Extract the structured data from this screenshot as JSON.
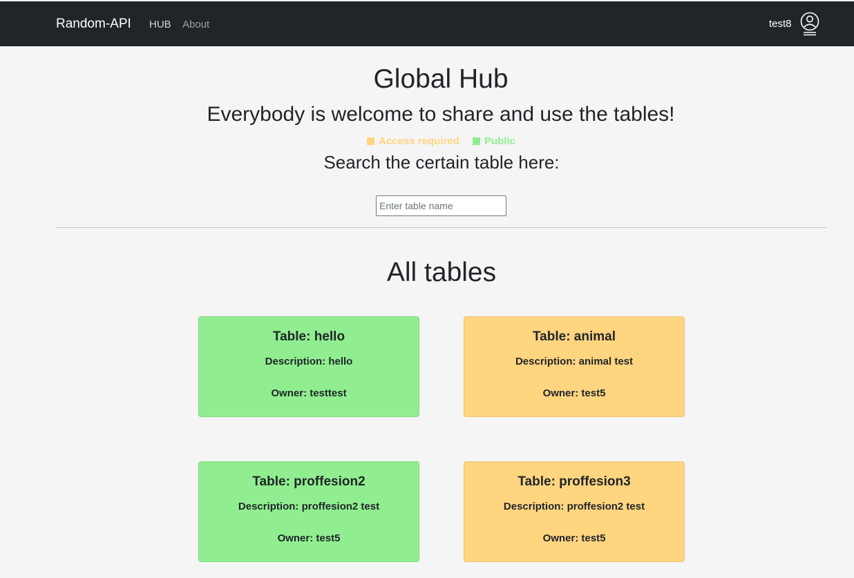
{
  "navbar": {
    "brand": "Random-API",
    "links": [
      "HUB",
      "About"
    ],
    "username": "test8",
    "user_icon": "user-circle-icon"
  },
  "header": {
    "title": "Global Hub",
    "welcome": "Everybody is welcome to share and use the tables!",
    "legend": [
      {
        "label": "Access required",
        "color": "#ffd580"
      },
      {
        "label": "Public",
        "color": "#90ee90"
      }
    ],
    "search_heading": "Search the certain table here:",
    "search_placeholder": "Enter table name"
  },
  "main": {
    "section_title": "All tables",
    "cards": [
      {
        "title": "Table: hello",
        "description": "Description: hello",
        "owner": "Owner: testtest",
        "access": "public"
      },
      {
        "title": "Table: animal",
        "description": "Description: animal test",
        "owner": "Owner: test5",
        "access": "access-required"
      },
      {
        "title": "Table: proffesion2",
        "description": "Description: proffesion2 test",
        "owner": "Owner: test5",
        "access": "public"
      },
      {
        "title": "Table: proffesion3",
        "description": "Description: proffesion2 test",
        "owner": "Owner: test5",
        "access": "access-required"
      }
    ]
  },
  "colors": {
    "navbar_bg": "#212529",
    "page_bg": "#f5f5f5",
    "public": "#90ee90",
    "access_required": "#ffd580"
  }
}
